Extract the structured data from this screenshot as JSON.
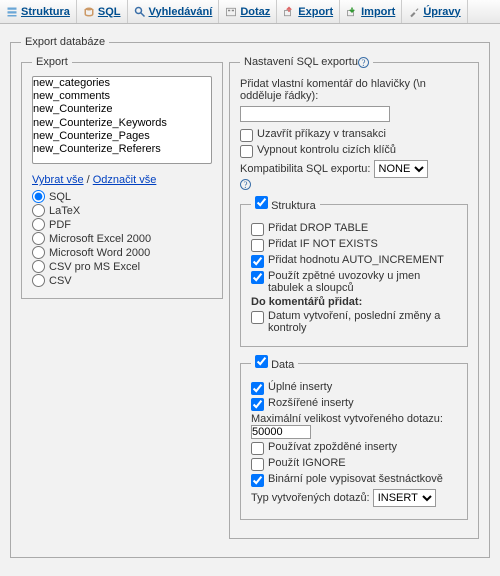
{
  "tabs": {
    "struktura": "Struktura",
    "sql": "SQL",
    "vyhledavani": "Vyhledávání",
    "dotaz": "Dotaz",
    "export": "Export",
    "import": "Import",
    "upravy": "Úpravy"
  },
  "title": "Export databáze",
  "export_box": {
    "legend": "Export",
    "tables": [
      "new_categories",
      "new_comments",
      "new_Counterize",
      "new_Counterize_Keywords",
      "new_Counterize_Pages",
      "new_Counterize_Referers"
    ],
    "select_all": "Vybrat vše",
    "unselect_all": "Odznačit vše",
    "formats": [
      "SQL",
      "LaTeX",
      "PDF",
      "Microsoft Excel 2000",
      "Microsoft Word 2000",
      "CSV pro MS Excel",
      "CSV"
    ],
    "format_selected": "SQL"
  },
  "options": {
    "legend": "Nastavení SQL exportu",
    "header_comment_label": "Přidat vlastní komentář do hlavičky (\\n odděluje řádky):",
    "header_comment_value": "",
    "enclose_transaction": "Uzavřít příkazy v transakci",
    "disable_fk": "Vypnout kontrolu cizích klíčů",
    "compat_label": "Kompatibilita SQL exportu:",
    "compat_value": "NONE",
    "structure": {
      "legend": "Struktura",
      "enabled": true,
      "drop_table": "Přidat DROP TABLE",
      "if_not_exists": "Přidat IF NOT EXISTS",
      "auto_increment": "Přidat hodnotu AUTO_INCREMENT",
      "backquotes": "Použít zpětné uvozovky u jmen tabulek a sloupců",
      "comments_add_label": "Do komentářů přidat:",
      "dates": "Datum vytvoření, poslední změny a kontroly"
    },
    "data": {
      "legend": "Data",
      "enabled": true,
      "complete_inserts": "Úplné inserty",
      "extended_inserts": "Rozšířené inserty",
      "max_query_label": "Maximální velikost vytvořeného dotazu:",
      "max_query_value": "50000",
      "delayed_inserts": "Používat zpožděné inserty",
      "use_ignore": "Použít IGNORE",
      "hex_blob": "Binární pole vypisovat šestnáctkově",
      "query_type_label": "Typ vytvořených dotazů:",
      "query_type_value": "INSERT"
    }
  }
}
